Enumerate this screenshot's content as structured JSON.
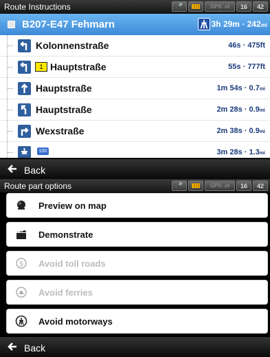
{
  "top_panel": {
    "title": "Route Instructions",
    "status": {
      "gps_label": "GPS",
      "hour": "16",
      "minute": "42"
    }
  },
  "route_header": {
    "road": "B207-E47  Fehmarn",
    "summary": "3h 29m · 242",
    "summary_unit": "mi"
  },
  "instructions": [
    {
      "street": "Kolonnenstraße",
      "time": "46s",
      "dist": "475",
      "unit": "ft",
      "turn_icon": "turn-left-icon"
    },
    {
      "street": "Hauptstraße",
      "exit_badge": "1",
      "time": "55s",
      "dist": "777",
      "unit": "ft",
      "turn_icon": "keep-left-icon"
    },
    {
      "street": "Hauptstraße",
      "time": "1m 54s",
      "dist": "0.7",
      "unit": "mi",
      "turn_icon": "straight-icon"
    },
    {
      "street": "Hauptstraße",
      "time": "2m 28s",
      "dist": "0.9",
      "unit": "mi",
      "turn_icon": "slight-left-icon"
    },
    {
      "street": "Wexstraße",
      "time": "2m 38s",
      "dist": "0.9",
      "unit": "mi",
      "turn_icon": "turn-right-icon"
    },
    {
      "street": "",
      "shield": "100",
      "time": "3m 28s",
      "dist": "1.3",
      "unit": "mi",
      "turn_icon": "motorway-icon"
    }
  ],
  "back_label": "Back",
  "bottom_panel": {
    "title": "Route part options",
    "status": {
      "gps_label": "GPS",
      "hour": "16",
      "minute": "42"
    }
  },
  "options": [
    {
      "label": "Preview on map",
      "enabled": true,
      "icon": "globe-icon"
    },
    {
      "label": "Demonstrate",
      "enabled": true,
      "icon": "clapperboard-icon"
    },
    {
      "label": "Avoid toll roads",
      "enabled": false,
      "icon": "dollar-icon"
    },
    {
      "label": "Avoid ferries",
      "enabled": false,
      "icon": "ferry-icon"
    },
    {
      "label": "Avoid motorways",
      "enabled": true,
      "icon": "motorway-icon"
    }
  ],
  "colors": {
    "header_blue": "#3e8ad8",
    "turn_blue": "#2f5f9e",
    "exit_yellow": "#ffe800"
  }
}
